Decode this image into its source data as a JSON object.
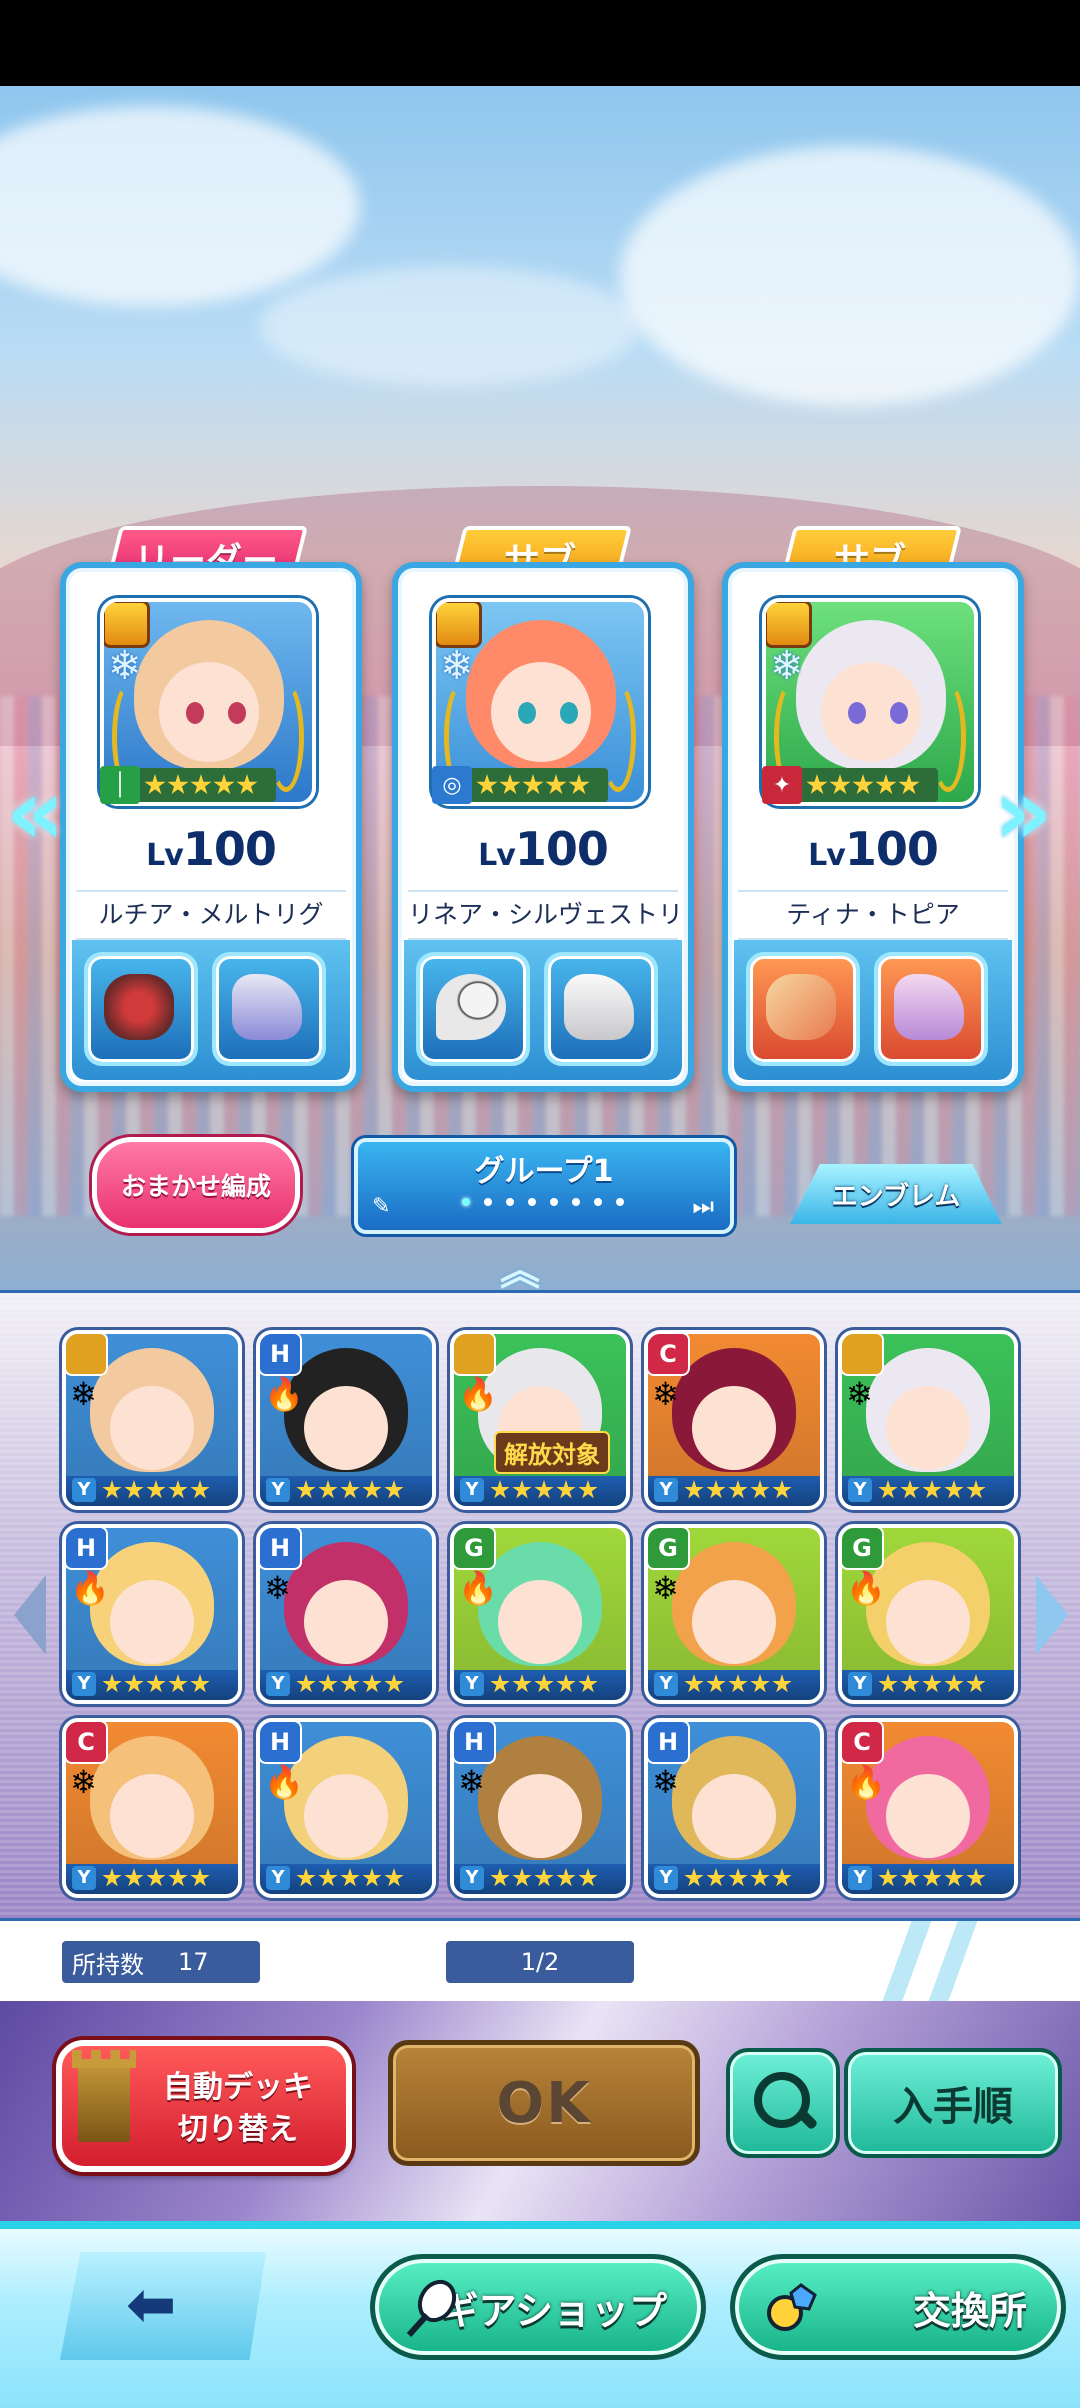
{
  "leader_tag": "リーダー",
  "sub_tag": "サブ",
  "deck": [
    {
      "role": "リーダー",
      "level_prefix": "Lv",
      "level": "100",
      "name": "ルチア・メルトリグ",
      "hair": "#f3c9a0",
      "bg": "#3f8fd8",
      "type_color": "#26a046"
    },
    {
      "role": "サブ",
      "level_prefix": "Lv",
      "level": "100",
      "name": "リネア・シルヴェストリ",
      "hair": "#ff8a6a",
      "bg": "#44a6e6",
      "type_color": "#2c7ad0"
    },
    {
      "role": "サブ",
      "level_prefix": "Lv",
      "level": "100",
      "name": "ティナ・トピア",
      "hair": "#ece8f2",
      "bg": "#3cc25a",
      "type_color": "#c8283a"
    }
  ],
  "buttons": {
    "auto_form": "おまかせ編成",
    "group_title": "グループ1",
    "emblem": "エンブレム",
    "auto_deck_line1": "自動デッキ",
    "auto_deck_line2": "切り替え",
    "ok": "OK",
    "sort": "入手順",
    "gear_shop": "ギアショップ",
    "exchange": "交換所"
  },
  "units": [
    {
      "rank": "",
      "hair": "#f3c9a0",
      "bg": "#3f8fd8",
      "rank_color": "#e0a020",
      "element": "❄"
    },
    {
      "rank": "H",
      "hair": "#222222",
      "bg": "#3f8fd8",
      "rank_color": "#2b6fd0",
      "element": "🔥"
    },
    {
      "rank": "",
      "hair": "#e8e8ec",
      "bg": "#3cc25a",
      "rank_color": "#e0a020",
      "element": "🔥",
      "release": "解放対象"
    },
    {
      "rank": "C",
      "hair": "#8a1838",
      "bg": "#f28a32",
      "rank_color": "#d02846",
      "element": "❄"
    },
    {
      "rank": "",
      "hair": "#ece8f2",
      "bg": "#3cc25a",
      "rank_color": "#e0a020",
      "element": "❄"
    },
    {
      "rank": "H",
      "hair": "#f7d27a",
      "bg": "#3f8fd8",
      "rank_color": "#2b6fd0",
      "element": "🔥"
    },
    {
      "rank": "H",
      "hair": "#c2306a",
      "bg": "#3f8fd8",
      "rank_color": "#2b6fd0",
      "element": "❄"
    },
    {
      "rank": "G",
      "hair": "#6adcaa",
      "bg": "#a0d83a",
      "rank_color": "#2e9a3a",
      "element": "🔥"
    },
    {
      "rank": "G",
      "hair": "#f2a24a",
      "bg": "#a0d83a",
      "rank_color": "#2e9a3a",
      "element": "❄"
    },
    {
      "rank": "G",
      "hair": "#f4d06a",
      "bg": "#a0d83a",
      "rank_color": "#2e9a3a",
      "element": "🔥"
    },
    {
      "rank": "C",
      "hair": "#f5c07a",
      "bg": "#f28a32",
      "rank_color": "#d02846",
      "element": "❄"
    },
    {
      "rank": "H",
      "hair": "#f3d07a",
      "bg": "#3f8fd8",
      "rank_color": "#2b6fd0",
      "element": "🔥"
    },
    {
      "rank": "H",
      "hair": "#b08040",
      "bg": "#3f8fd8",
      "rank_color": "#2b6fd0",
      "element": "❄"
    },
    {
      "rank": "H",
      "hair": "#e0b85a",
      "bg": "#3f8fd8",
      "rank_color": "#2b6fd0",
      "element": "❄"
    },
    {
      "rank": "C",
      "hair": "#f06aa0",
      "bg": "#f28a32",
      "rank_color": "#d02846",
      "element": "🔥"
    }
  ],
  "owned_label": "所持数",
  "owned_count": "17",
  "page": "1/2",
  "icons": [
    "gift-icon",
    "snowflake-icon",
    "arrow-left-icon",
    "arrow-right-icon",
    "pencil-icon",
    "fast-forward-icon",
    "chevron-up-icon",
    "search-icon",
    "tower-icon",
    "back-arrow-icon",
    "racket-icon",
    "gem-icon"
  ]
}
